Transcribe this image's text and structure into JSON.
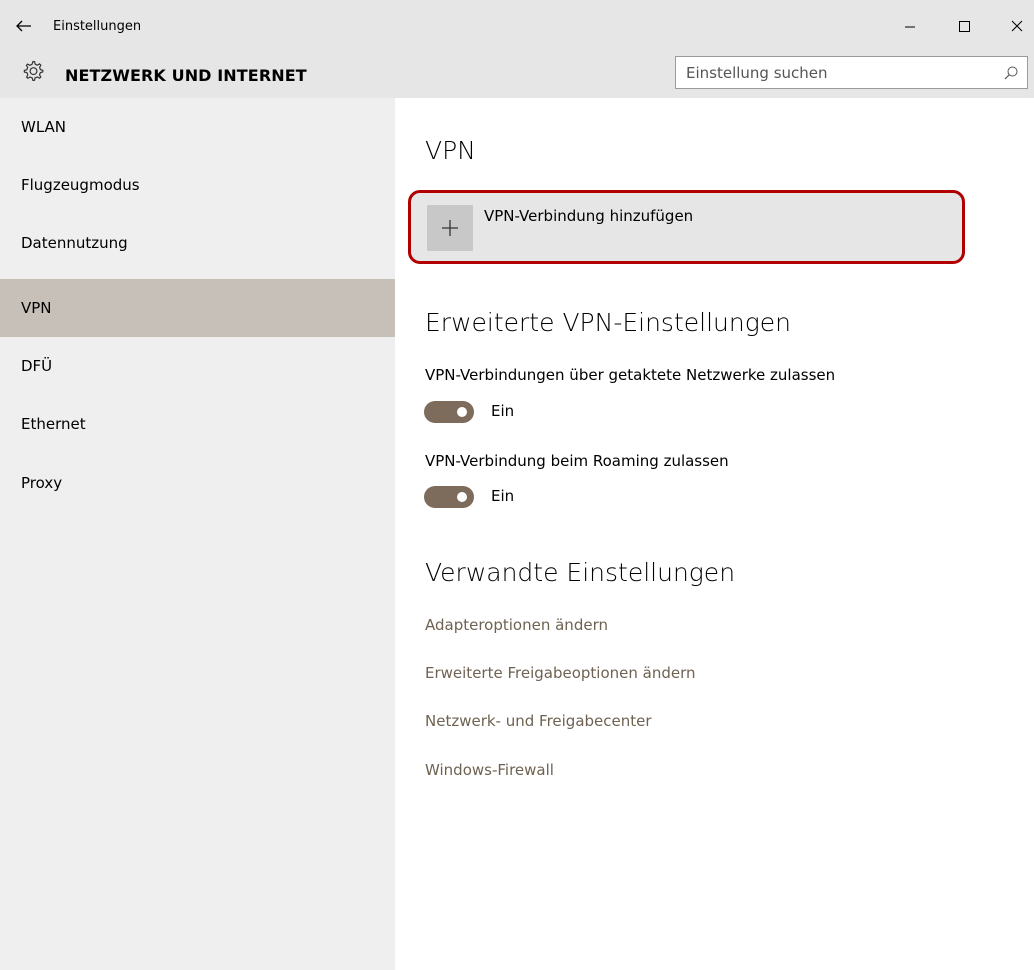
{
  "window": {
    "title": "Einstellungen",
    "controls": {
      "minimize": "minimize-icon",
      "maximize": "maximize-icon",
      "close": "close-icon"
    }
  },
  "header": {
    "section_title": "NETZWERK UND INTERNET",
    "search_placeholder": "Einstellung suchen"
  },
  "sidebar": {
    "items": [
      {
        "label": "WLAN",
        "active": false
      },
      {
        "label": "Flugzeugmodus",
        "active": false
      },
      {
        "label": "Datennutzung",
        "active": false
      },
      {
        "label": "VPN",
        "active": true
      },
      {
        "label": "DFÜ",
        "active": false
      },
      {
        "label": "Ethernet",
        "active": false
      },
      {
        "label": "Proxy",
        "active": false
      }
    ]
  },
  "main": {
    "heading": "VPN",
    "add_vpn_label": "VPN-Verbindung hinzufügen",
    "advanced_heading": "Erweiterte VPN-Einstellungen",
    "options": [
      {
        "label": "VPN-Verbindungen über getaktete Netzwerke zulassen",
        "state": "Ein"
      },
      {
        "label": "VPN-Verbindung beim Roaming zulassen",
        "state": "Ein"
      }
    ],
    "related_heading": "Verwandte Einstellungen",
    "related_links": [
      "Adapteroptionen ändern",
      "Erweiterte Freigabeoptionen ändern",
      "Netzwerk- und Freigabecenter",
      "Windows-Firewall"
    ]
  },
  "colors": {
    "accent": "#7d6c5c",
    "selected_nav": "#c7c0b8",
    "highlight_border": "#b20000",
    "link": "#6f6252"
  }
}
